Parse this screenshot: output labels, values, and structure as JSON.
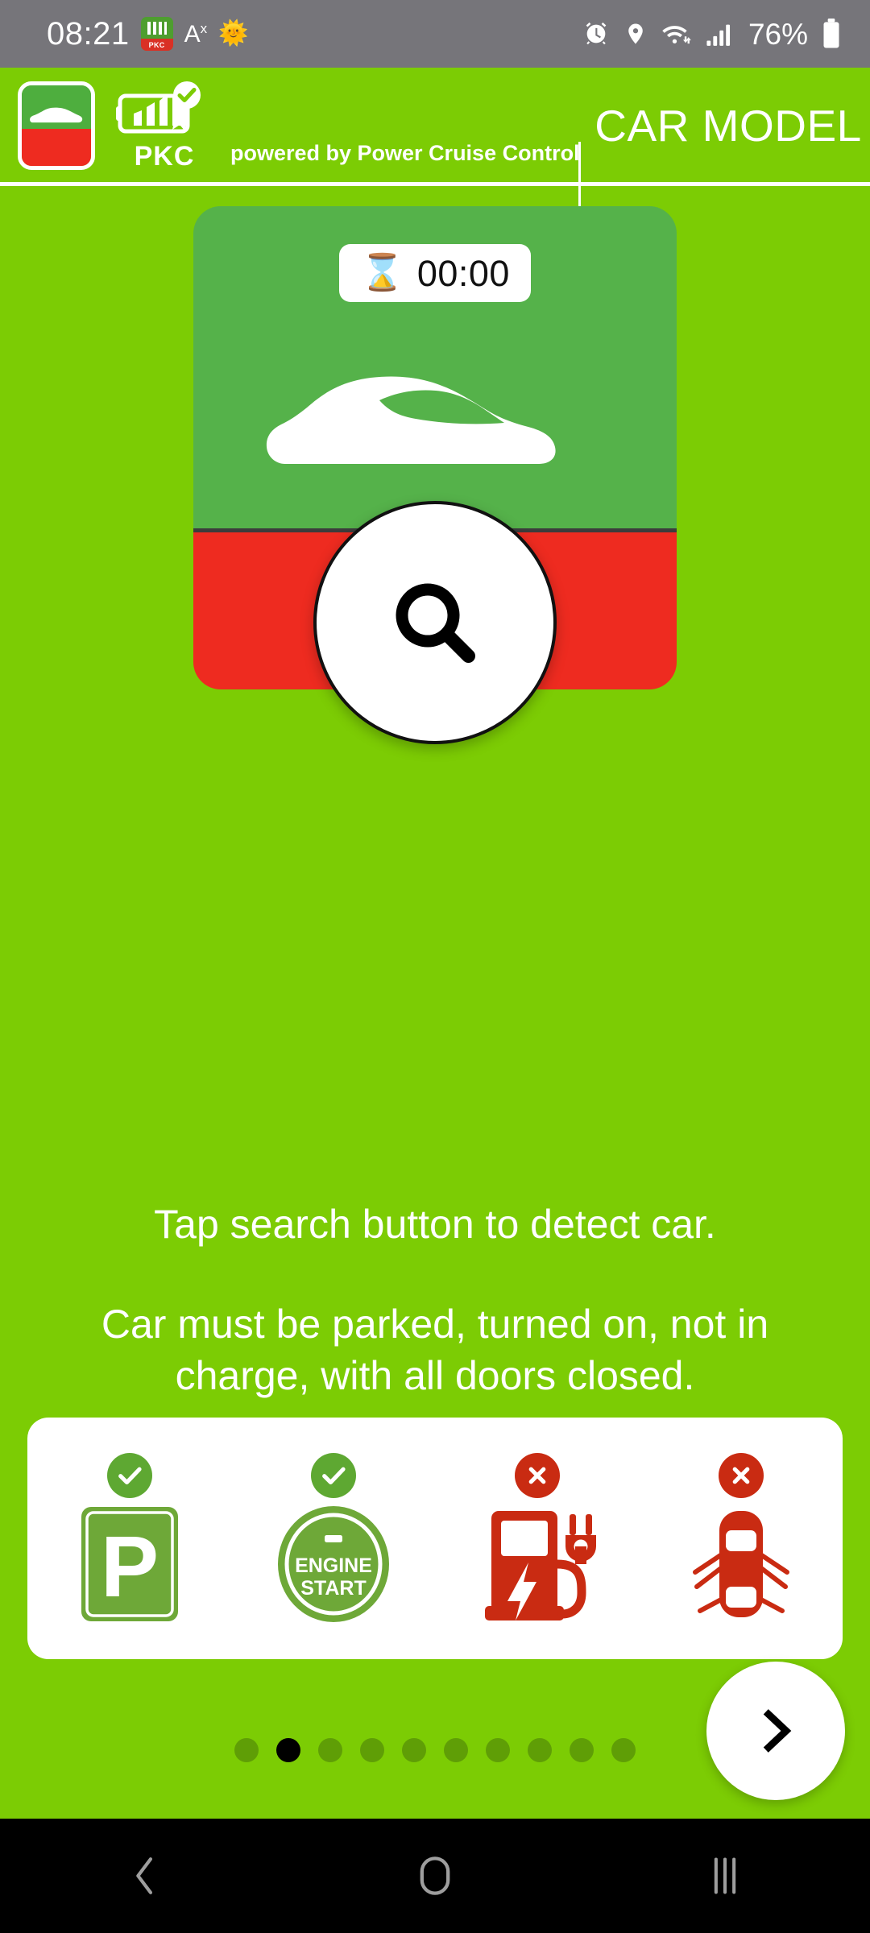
{
  "status_bar": {
    "time": "08:21",
    "app_badge_label": "PKC",
    "font_size_icon": "A",
    "font_size_sup": "x",
    "weather_icon": "sun-icon",
    "icons": [
      "alarm-icon",
      "location-icon",
      "wifi-icon",
      "signal-icon"
    ],
    "battery_percent": "76%",
    "battery_icon": "battery-icon"
  },
  "header": {
    "app_icon_name": "car-app-icon",
    "logo_name": "pkc-battery-logo",
    "brand_short": "PKC",
    "powered_by": "powered by Power Cruise Control",
    "title": "CAR MODEL"
  },
  "detect_card": {
    "timer_icon": "hourglass-icon",
    "timer_value": "00:00",
    "car_icon": "car-silhouette-icon",
    "top_color": "#55B24A",
    "bottom_color": "#EE2B20"
  },
  "search_button": {
    "icon": "search-icon",
    "label": "Search"
  },
  "instructions": {
    "line1": "Tap search button to detect car.",
    "line2": "Car must be parked, turned on, not in charge, with all doors closed."
  },
  "conditions": [
    {
      "id": "parked",
      "status": "ok",
      "status_icon": "check-icon",
      "glyph": "parking-sign-icon",
      "label": "P"
    },
    {
      "id": "engine-on",
      "status": "ok",
      "status_icon": "check-icon",
      "glyph": "engine-start-icon",
      "label_line1": "ENGINE",
      "label_line2": "START"
    },
    {
      "id": "not-charging",
      "status": "no",
      "status_icon": "cross-icon",
      "glyph": "charging-station-icon",
      "label": ""
    },
    {
      "id": "doors-closed",
      "status": "no",
      "status_icon": "cross-icon",
      "glyph": "car-doors-open-icon",
      "label": ""
    }
  ],
  "next_button": {
    "icon": "chevron-right-icon",
    "label": "Next"
  },
  "pagination": {
    "total": 10,
    "active_index": 1,
    "dot_color": "#5F9E06",
    "active_color": "#000000"
  },
  "nav_bar": {
    "back": "back-icon",
    "home": "home-icon",
    "recents": "recents-icon"
  },
  "colors": {
    "brand_green": "#7CCC04",
    "card_green": "#55B24A",
    "alert_red": "#EE2B20",
    "status_bar_gray": "#76757A"
  }
}
